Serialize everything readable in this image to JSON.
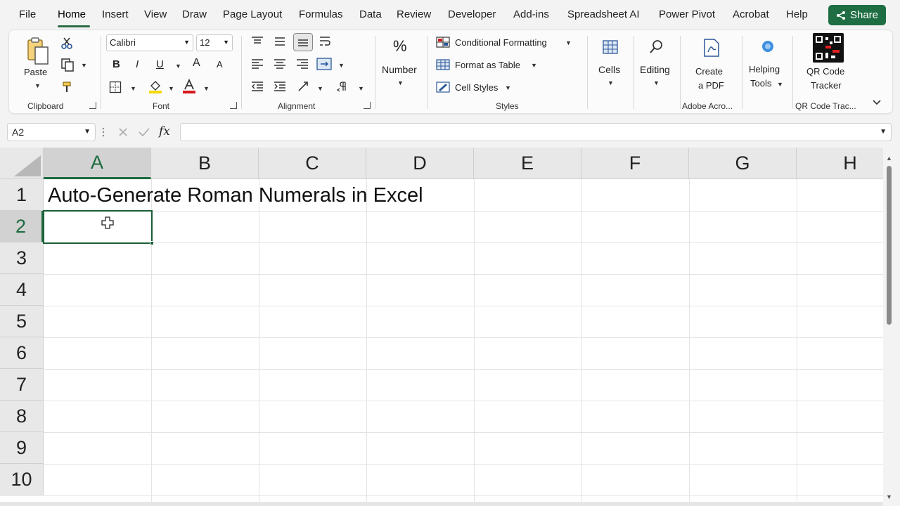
{
  "menu": {
    "items": [
      "File",
      "Home",
      "Insert",
      "View",
      "Draw",
      "Page Layout",
      "Formulas",
      "Data",
      "Review",
      "Developer",
      "Add-ins",
      "Spreadsheet AI",
      "Power Pivot",
      "Acrobat",
      "Help"
    ],
    "active": "Home",
    "share_label": "Share"
  },
  "ribbon": {
    "clipboard": {
      "paste": "Paste",
      "label": "Clipboard"
    },
    "font": {
      "name": "Calibri",
      "size": "12",
      "bold": "B",
      "italic": "I",
      "underline": "U",
      "grow": "A",
      "shrink": "A",
      "label": "Font"
    },
    "alignment": {
      "label": "Alignment"
    },
    "number": {
      "symbol": "%",
      "label": "Number"
    },
    "styles": {
      "conditional": "Conditional Formatting",
      "format_table": "Format as Table",
      "cell_styles": "Cell Styles",
      "label": "Styles"
    },
    "cells": {
      "label": "Cells"
    },
    "editing": {
      "label": "Editing"
    },
    "adobe": {
      "line1": "Create",
      "line2": "a PDF",
      "label": "Adobe Acro..."
    },
    "helping": {
      "line1": "Helping",
      "line2": "Tools"
    },
    "qr": {
      "line1": "QR Code",
      "line2": "Tracker",
      "label": "QR Code Trac..."
    }
  },
  "formula_bar": {
    "name_box": "A2",
    "fx": "fx",
    "value": ""
  },
  "sheet": {
    "columns": [
      "A",
      "B",
      "C",
      "D",
      "E",
      "F",
      "G",
      "H"
    ],
    "rows": [
      "1",
      "2",
      "3",
      "4",
      "5",
      "6",
      "7",
      "8",
      "9",
      "10"
    ],
    "selected_column": "A",
    "selected_row": "2",
    "cells": {
      "A1": "Auto-Generate Roman Numerals in Excel"
    }
  },
  "colors": {
    "accent": "#1b6a3e",
    "share_bg": "#1f6e43"
  }
}
